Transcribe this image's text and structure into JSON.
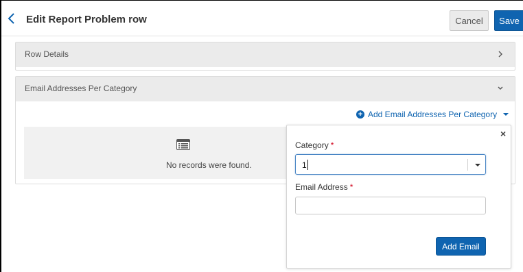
{
  "header": {
    "title": "Edit Report Problem row",
    "cancel_label": "Cancel",
    "save_label": "Save"
  },
  "sections": [
    {
      "label": "Row Details",
      "state": "collapsed"
    },
    {
      "label": "Email Addresses Per Category",
      "state": "expanded"
    }
  ],
  "add_link_label": "Add Email Addresses Per Category",
  "empty_state": {
    "text": "No records were found."
  },
  "popover": {
    "category_label": "Category",
    "category_value": "1",
    "email_label": "Email Address",
    "email_value": "",
    "required_marker": "*",
    "submit_label": "Add Email",
    "close_glyph": "×"
  },
  "colors": {
    "primary": "#0f64b0",
    "panel_header": "#ebebeb",
    "required": "#d0021b"
  }
}
